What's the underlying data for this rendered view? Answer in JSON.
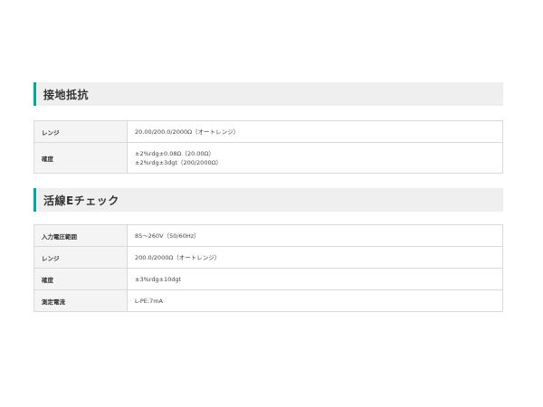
{
  "sections": [
    {
      "title": "接地抵抗",
      "rows": [
        {
          "label": "レンジ",
          "lines": [
            "20.00/200.0/2000Ω（オートレンジ）"
          ]
        },
        {
          "label": "確度",
          "lines": [
            "±2%rdg±0.08Ω（20.00Ω）",
            "±2%rdg±3dgt（200/2000Ω）"
          ]
        }
      ]
    },
    {
      "title": "活線Eチェック",
      "rows": [
        {
          "label": "入力電圧範囲",
          "lines": [
            "85～260V（50/60Hz）"
          ]
        },
        {
          "label": "レンジ",
          "lines": [
            "200.0/2000Ω（オートレンジ）"
          ]
        },
        {
          "label": "確度",
          "lines": [
            "±3%rdg±10dgt"
          ]
        },
        {
          "label": "測定電流",
          "lines": [
            "L-PE:7mA"
          ]
        }
      ]
    }
  ]
}
